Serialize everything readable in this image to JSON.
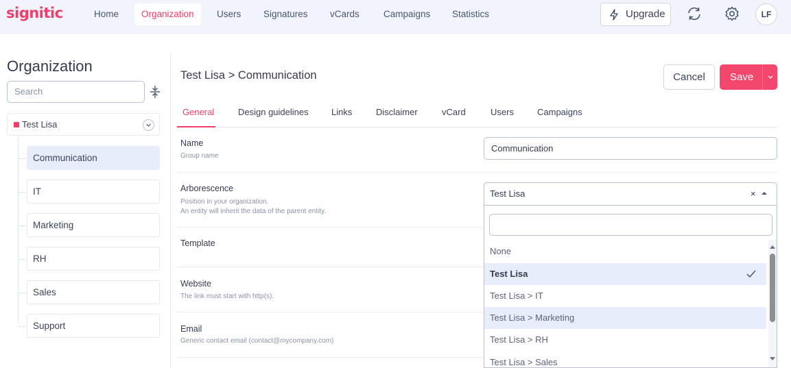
{
  "app": {
    "logo": "signitic"
  },
  "nav": {
    "items": [
      "Home",
      "Organization",
      "Users",
      "Signatures",
      "vCards",
      "Campaigns",
      "Statistics"
    ],
    "active_index": 1,
    "upgrade_label": "Upgrade",
    "avatar_initials": "LF"
  },
  "sidebar": {
    "title": "Organization",
    "search_placeholder": "Search",
    "root_label": "Test Lisa",
    "items": [
      "Communication",
      "IT",
      "Marketing",
      "RH",
      "Sales",
      "Support"
    ],
    "active_index": 0
  },
  "main": {
    "breadcrumb": "Test Lisa > Communication",
    "cancel_label": "Cancel",
    "save_label": "Save",
    "tabs": [
      "General",
      "Design guidelines",
      "Links",
      "Disclaimer",
      "vCard",
      "Users",
      "Campaigns"
    ],
    "active_tab": 0,
    "fields": {
      "name": {
        "label": "Name",
        "help": "Group name",
        "value": "Communication"
      },
      "arborescence": {
        "label": "Arborescence",
        "help_line1": "Position in your organization.",
        "help_line2": "An entity will inherit the data of the parent entity.",
        "value": "Test Lisa",
        "clear_symbol": "×"
      },
      "template": {
        "label": "Template"
      },
      "website": {
        "label": "Website",
        "help": "The link must start with http(s)."
      },
      "email": {
        "label": "Email",
        "help": "Generic contact email (contact@mycompany.com)"
      }
    },
    "dropdown": {
      "options": [
        "None",
        "Test Lisa",
        "Test Lisa > IT",
        "Test Lisa > Marketing",
        "Test Lisa > RH",
        "Test Lisa > Sales"
      ],
      "selected_index": 1,
      "hover_index": 3
    }
  },
  "colors": {
    "accent": "#ee3f6b",
    "save": "#f4476e",
    "nav_bg": "#f1f4fb",
    "selected_bg": "#e8eef9"
  }
}
